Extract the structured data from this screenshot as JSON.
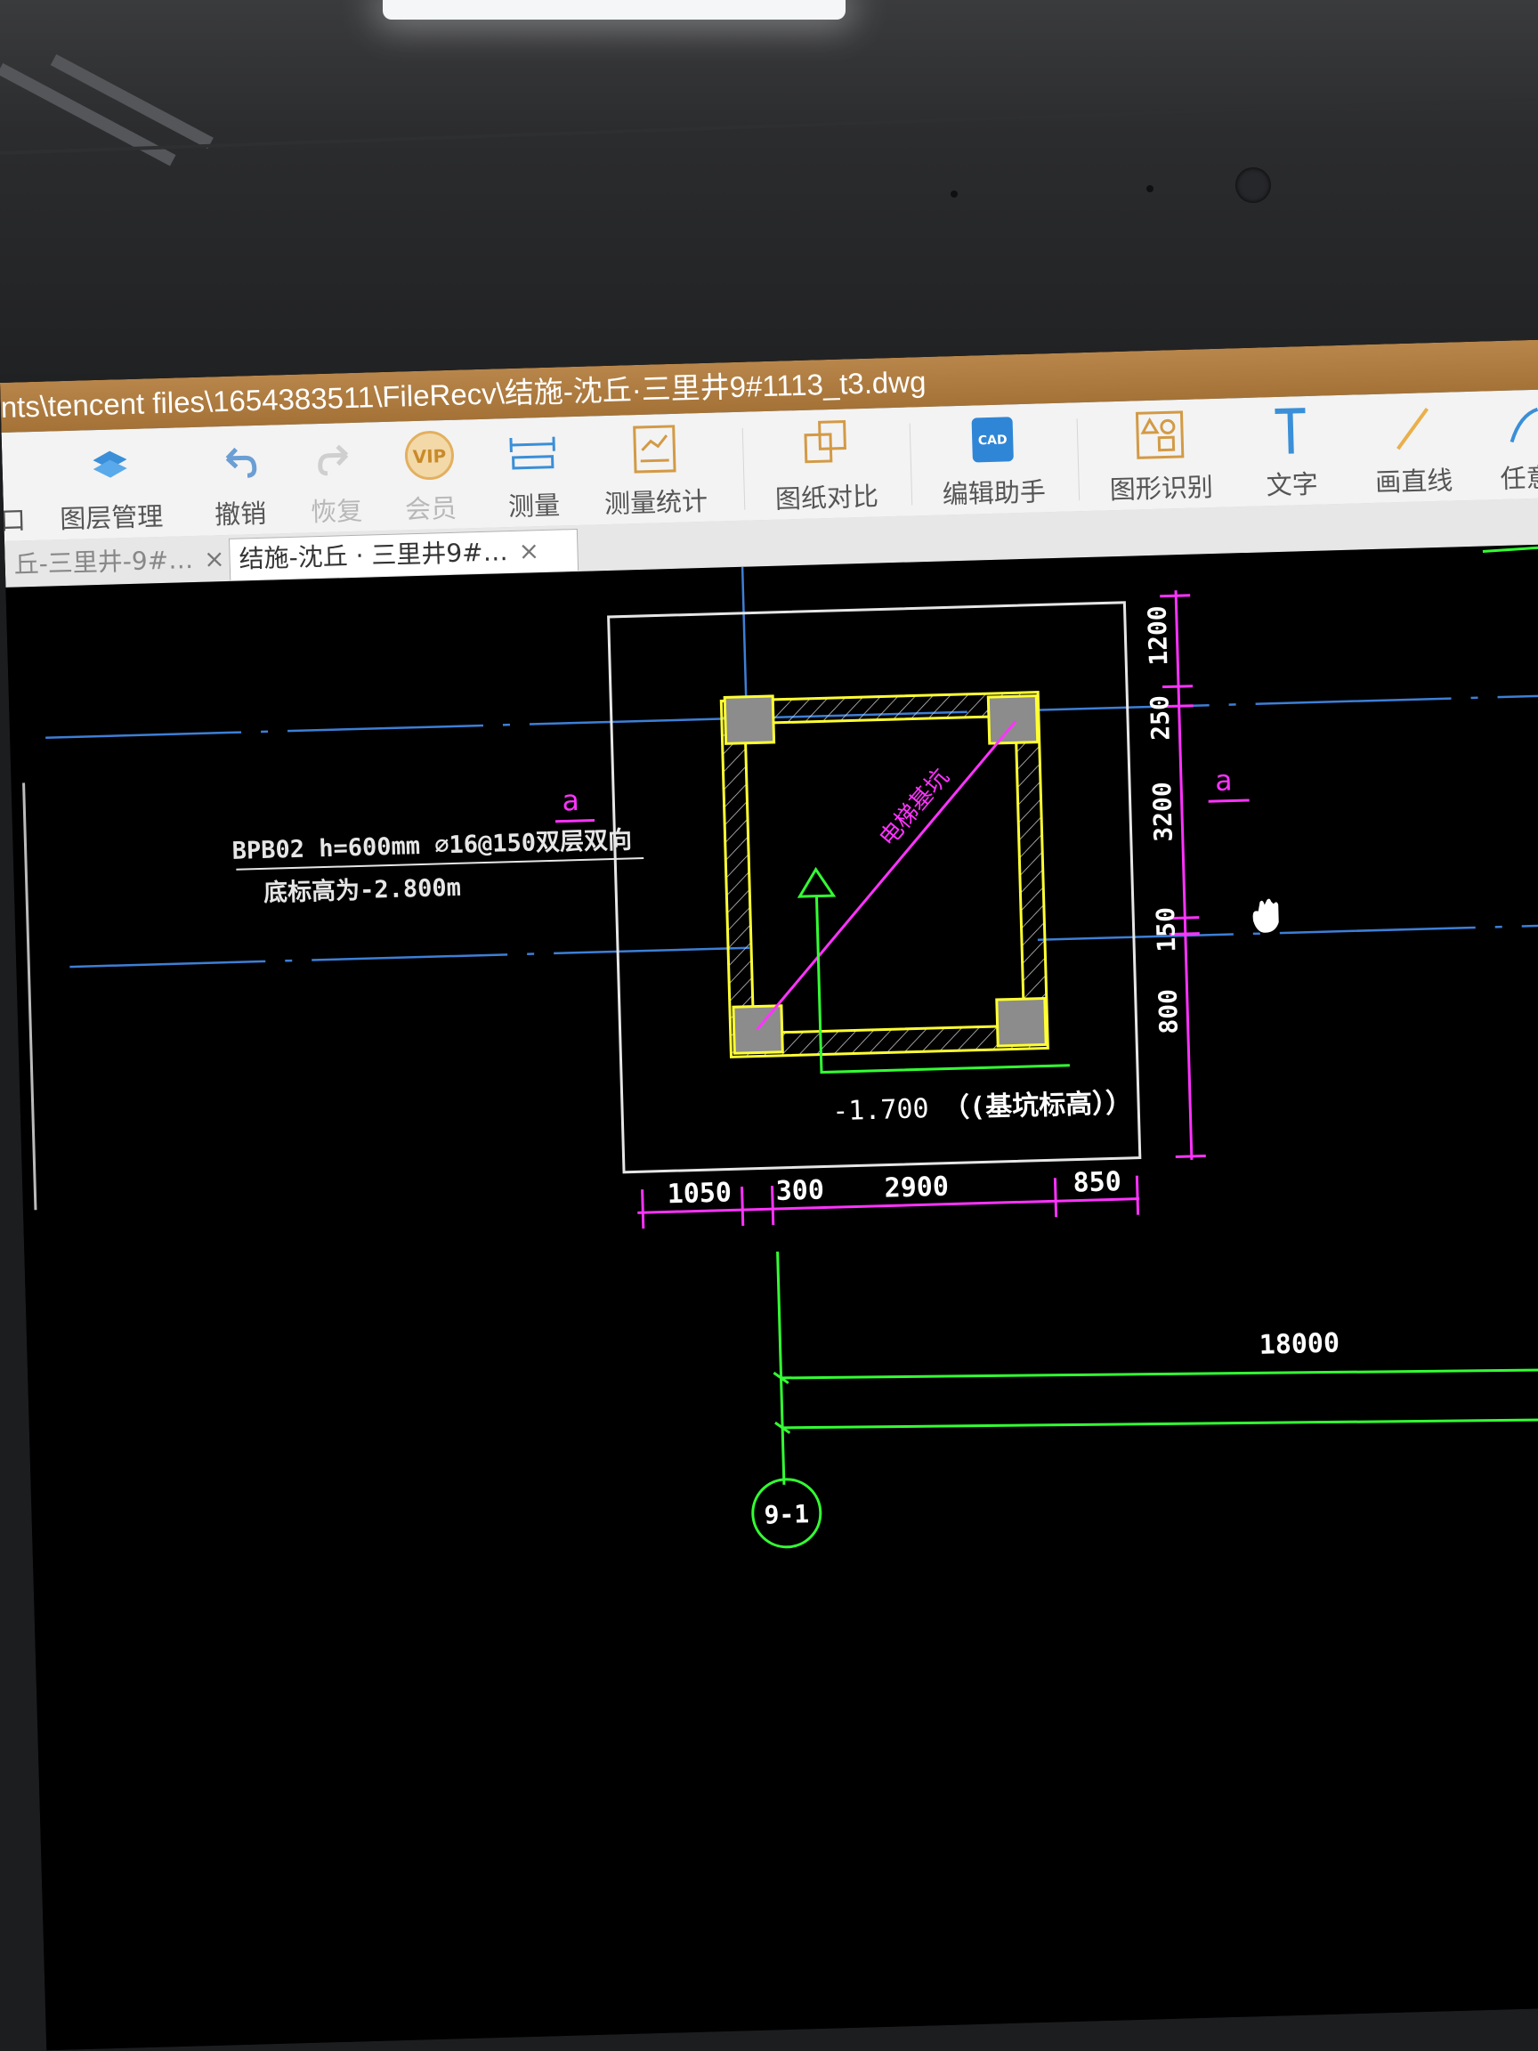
{
  "window": {
    "title_path": "nts\\tencent files\\1654383511\\FileRecv\\结施-沈丘·三里井9#1113_t3.dwg"
  },
  "toolbar": {
    "items": [
      {
        "label": "口"
      },
      {
        "label": "图层管理",
        "icon": "layers-icon"
      },
      {
        "label": "撤销",
        "icon": "undo-icon"
      },
      {
        "label": "恢复",
        "icon": "redo-icon"
      },
      {
        "label": "会员",
        "icon": "vip-icon",
        "badge": "VIP"
      },
      {
        "label": "测量",
        "icon": "measure-icon"
      },
      {
        "label": "测量统计",
        "icon": "measure-stats-icon"
      },
      {
        "label": "图纸对比",
        "icon": "compare-icon"
      },
      {
        "label": "编辑助手",
        "icon": "edit-assistant-icon",
        "badge": "CAD"
      },
      {
        "label": "图形识别",
        "icon": "shape-recognition-icon"
      },
      {
        "label": "文字",
        "icon": "text-icon"
      },
      {
        "label": "画直线",
        "icon": "line-icon"
      },
      {
        "label": "任意",
        "icon": "freehand-icon"
      }
    ]
  },
  "tabs": [
    {
      "label": "丘-三里井-9#…",
      "close": "×"
    },
    {
      "label": "结施-沈丘 · 三里井9#…",
      "close": "×"
    }
  ],
  "drawing": {
    "note_line1": "BPB02 h=600mm ⌀16@150双层双向",
    "note_line2": "底标高为-2.800m",
    "section_mark_left": "a",
    "section_mark_right": "a",
    "diagonal_label": "电梯基坑",
    "elevation_value": "-1.700",
    "elevation_note": "（(基坑标高））",
    "dims_horizontal": [
      "1050",
      "300",
      "2900",
      "850"
    ],
    "dims_vertical": [
      "1200",
      "250",
      "3200",
      "150",
      "800"
    ],
    "dim_18000": "18000",
    "axis_label": "9-1"
  },
  "colors": {
    "background": "#000000",
    "outline": "#e6e6e6",
    "wall": "#ffff33",
    "dimension": "#ff33ff",
    "axis": "#33ff33",
    "center_line": "#3d7fd6"
  }
}
